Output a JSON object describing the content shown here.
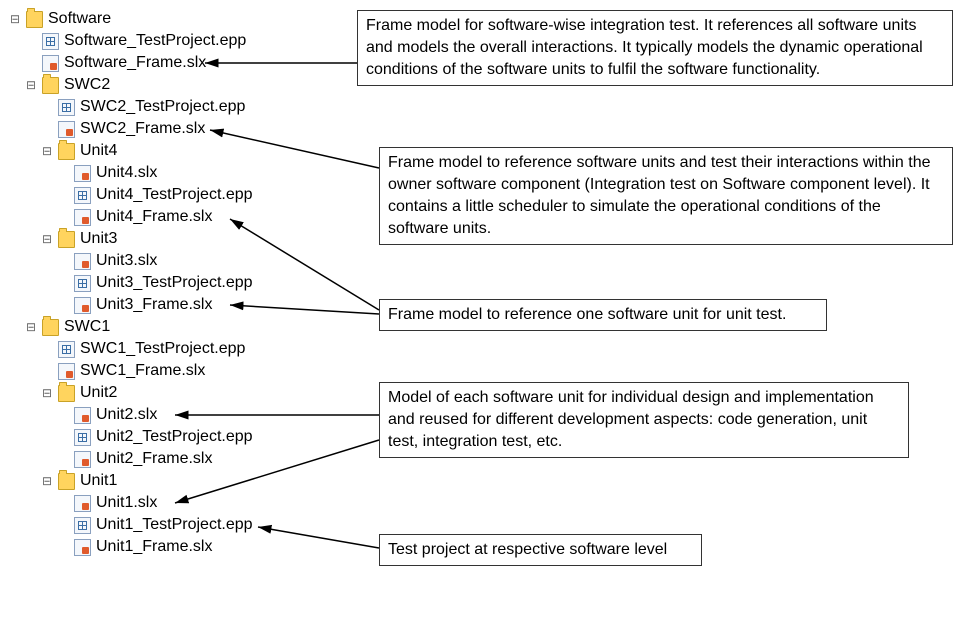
{
  "tree": {
    "n0": "Software",
    "n1": "Software_TestProject.epp",
    "n2": "Software_Frame.slx",
    "n3": "SWC2",
    "n4": "SWC2_TestProject.epp",
    "n5": "SWC2_Frame.slx",
    "n6": "Unit4",
    "n7": "Unit4.slx",
    "n8": "Unit4_TestProject.epp",
    "n9": "Unit4_Frame.slx",
    "n10": "Unit3",
    "n11": "Unit3.slx",
    "n12": "Unit3_TestProject.epp",
    "n13": "Unit3_Frame.slx",
    "n14": "SWC1",
    "n15": "SWC1_TestProject.epp",
    "n16": "SWC1_Frame.slx",
    "n17": "Unit2",
    "n18": "Unit2.slx",
    "n19": "Unit2_TestProject.epp",
    "n20": "Unit2_Frame.slx",
    "n21": "Unit1",
    "n22": "Unit1.slx",
    "n23": "Unit1_TestProject.epp",
    "n24": "Unit1_Frame.slx"
  },
  "callouts": {
    "c1": "Frame model for software-wise integration test. It references all software units and models the overall interactions. It typically models the dynamic operational conditions of the software units to fulfil the software functionality.",
    "c2": "Frame model to reference software units and test their interactions within the owner software component (Integration test on Software component level). It contains a little scheduler to simulate the operational conditions of the software units.",
    "c3": "Frame model to reference one software unit for unit test.",
    "c4": "Model of each software unit for individual design and implementation and reused for different development aspects: code generation, unit test, integration test, etc.",
    "c5": "Test project at respective software level"
  }
}
